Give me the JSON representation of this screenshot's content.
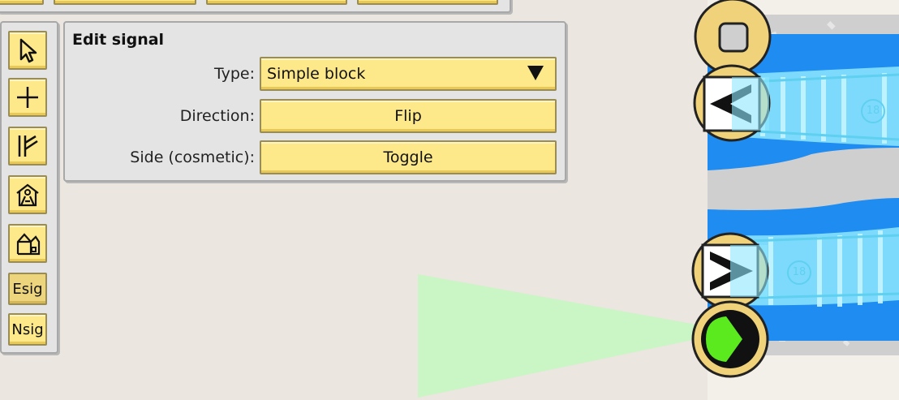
{
  "edit_signal": {
    "title": "Edit signal",
    "type_label": "Type:",
    "type_value": "Simple block",
    "direction_label": "Direction:",
    "direction_button": "Flip",
    "side_label": "Side (cosmetic):",
    "side_button": "Toggle"
  },
  "toolbar": {
    "esig": "Esig",
    "nsig": "Nsig"
  },
  "track": {
    "segment_a": "18",
    "segment_b": "18"
  },
  "colors": {
    "panel": "#e4e4e4",
    "button": "#fde88a",
    "water": "#1e8cf0",
    "track": "#8ee8ff",
    "signal_green": "#5aea1e"
  }
}
